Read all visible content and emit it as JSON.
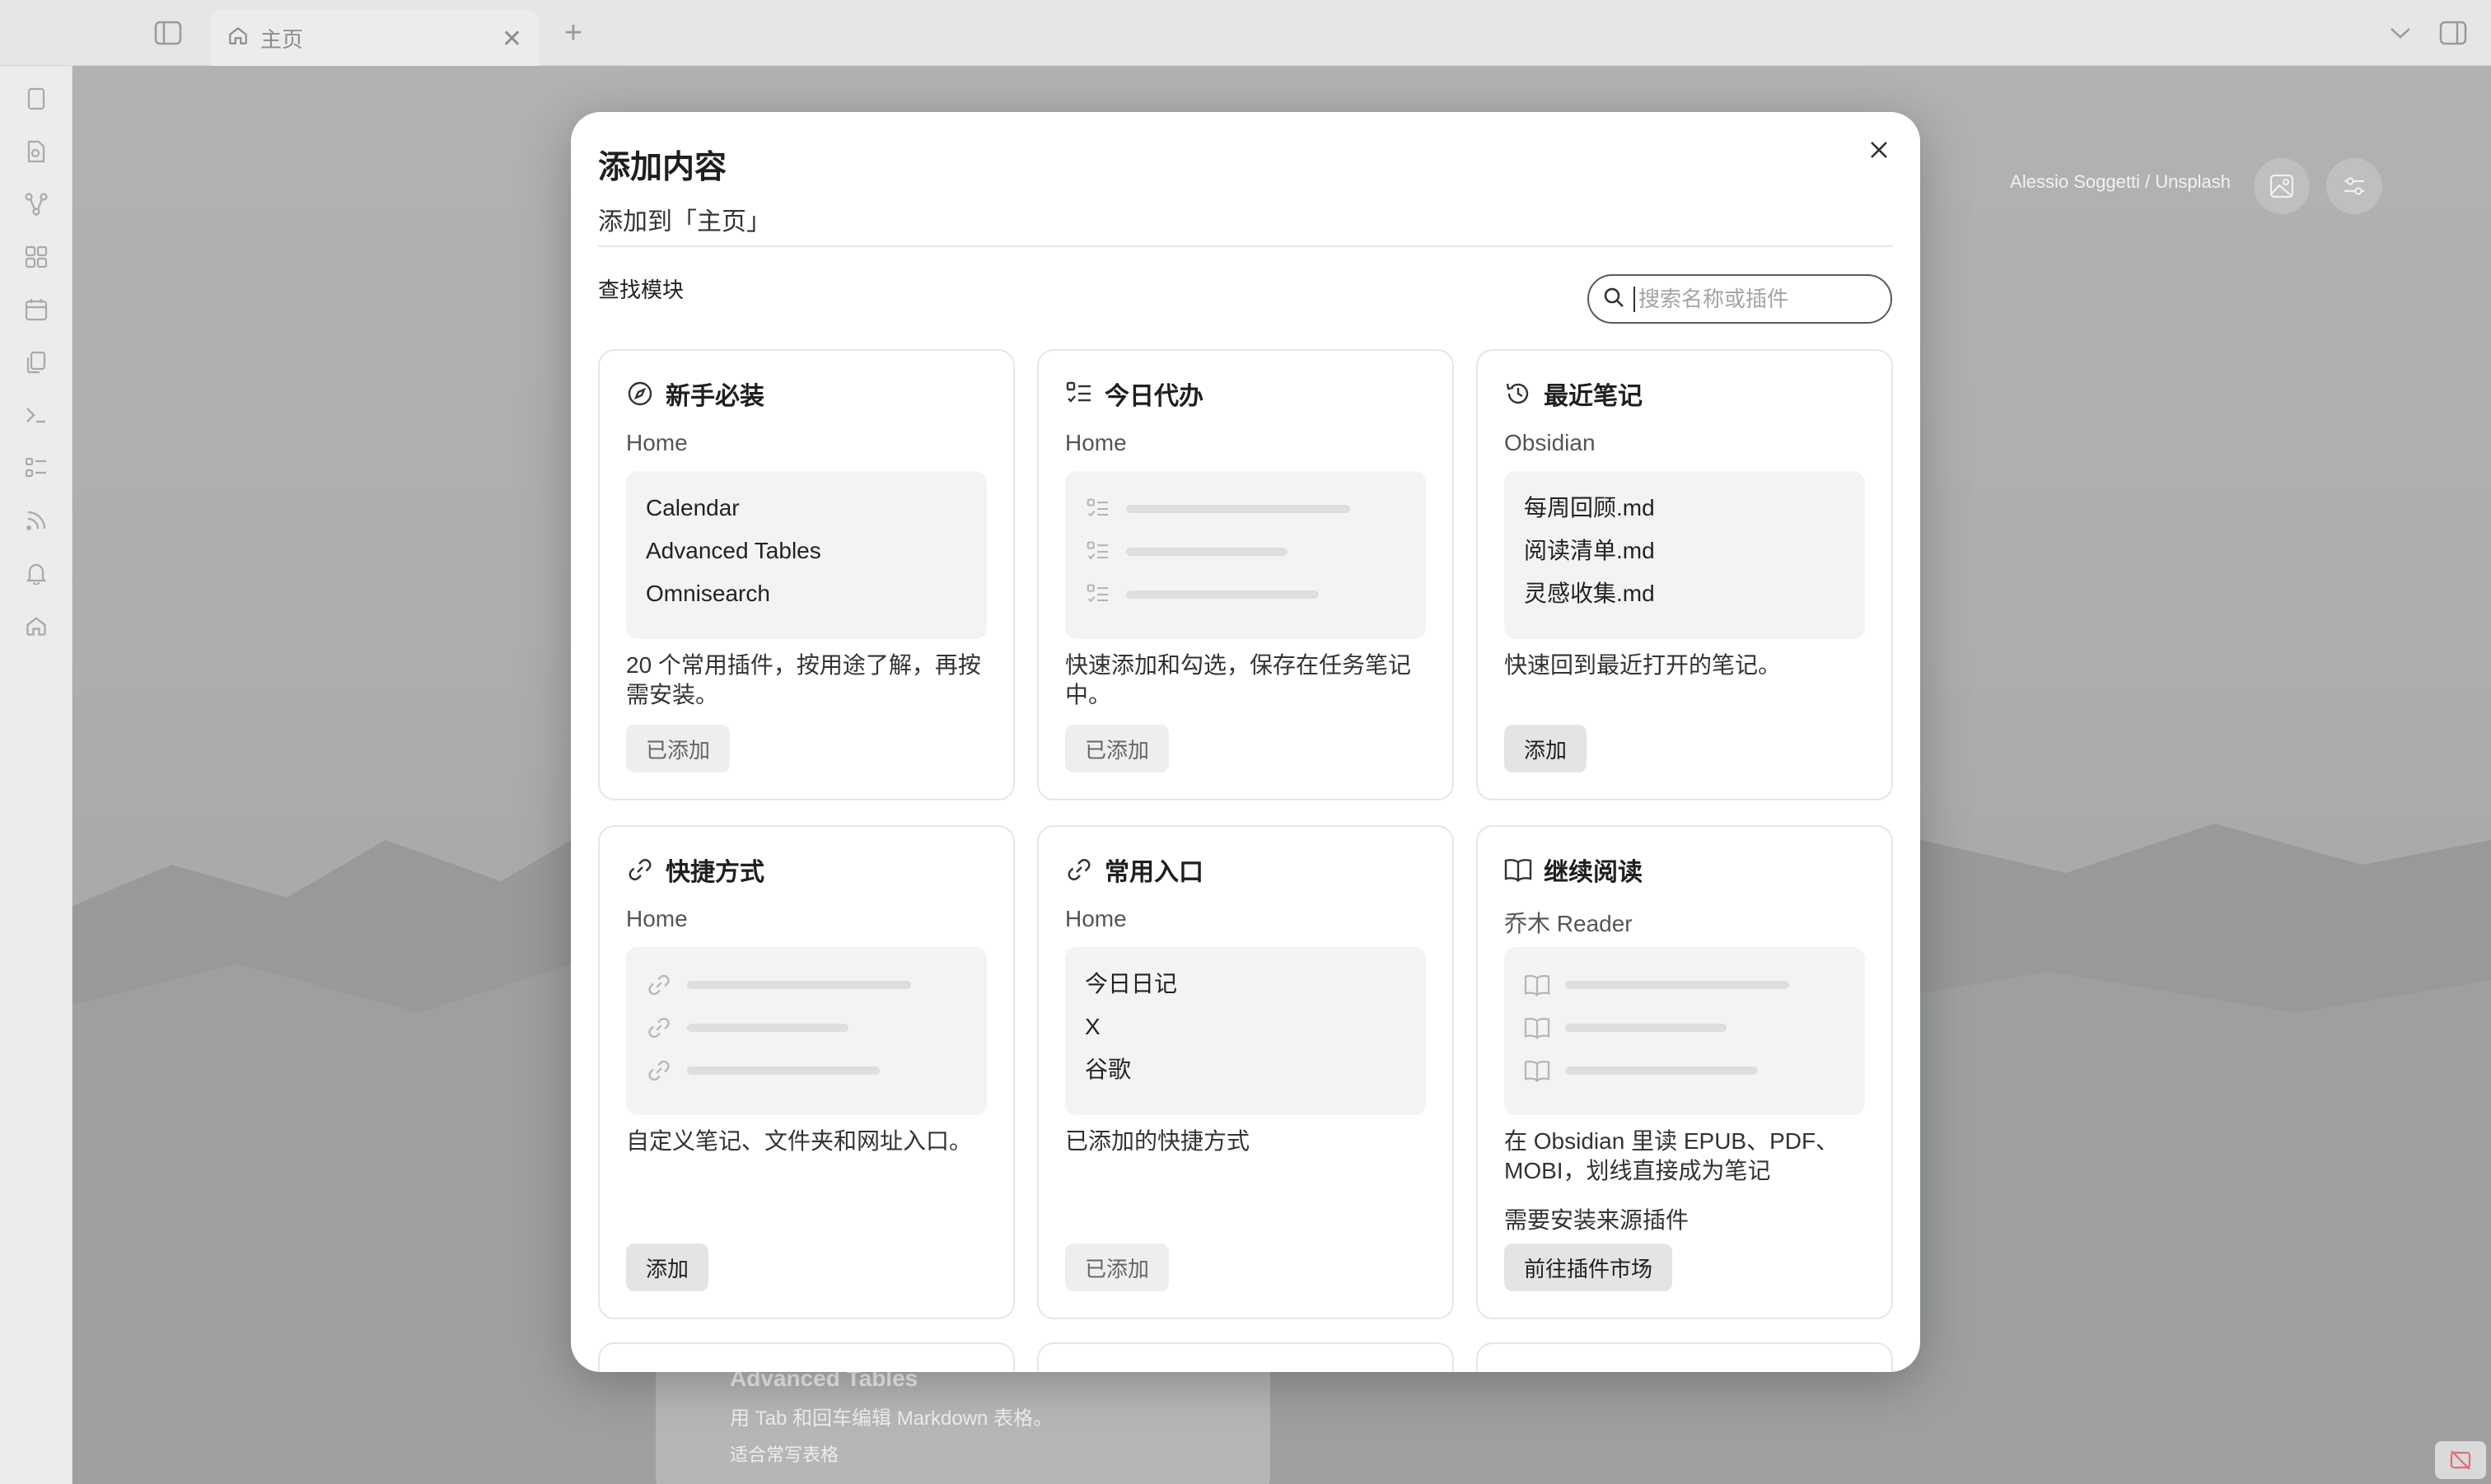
{
  "titlebar": {
    "tab_label": "主页"
  },
  "workspace": {
    "photo_credit": "Alessio Soggetti / Unsplash",
    "bg_card": {
      "title": "Advanced Tables",
      "desc": "用 Tab 和回车编辑 Markdown 表格。",
      "sub": "适合常写表格"
    }
  },
  "modal": {
    "title": "添加内容",
    "subtitle": "添加到「主页」",
    "find_label": "查找模块",
    "search_placeholder": "搜索名称或插件",
    "cards": [
      {
        "icon": "compass-icon",
        "title": "新手必装",
        "source": "Home",
        "preview_lines": [
          "Calendar",
          "Advanced Tables",
          "Omnisearch"
        ],
        "desc": "20 个常用插件，按用途了解，再按需安装。",
        "button": "已添加",
        "button_state": "added"
      },
      {
        "icon": "checklist-icon",
        "title": "今日代办",
        "source": "Home",
        "preview_skeleton": "checklist-icon",
        "desc": "快速添加和勾选，保存在任务笔记中。",
        "button": "已添加",
        "button_state": "added"
      },
      {
        "icon": "history-icon",
        "title": "最近笔记",
        "source": "Obsidian",
        "preview_lines": [
          "每周回顾.md",
          "阅读清单.md",
          "灵感收集.md"
        ],
        "desc": "快速回到最近打开的笔记。",
        "button": "添加",
        "button_state": "add"
      },
      {
        "icon": "link-icon",
        "title": "快捷方式",
        "source": "Home",
        "preview_skeleton": "link-icon",
        "desc": "自定义笔记、文件夹和网址入口。",
        "button": "添加",
        "button_state": "add"
      },
      {
        "icon": "link-icon",
        "title": "常用入口",
        "source": "Home",
        "preview_lines": [
          "今日日记",
          "X",
          "谷歌"
        ],
        "desc": "已添加的快捷方式",
        "button": "已添加",
        "button_state": "added"
      },
      {
        "icon": "book-icon",
        "title": "继续阅读",
        "source": "乔木 Reader",
        "preview_skeleton": "book-icon",
        "desc": "在 Obsidian 里读 EPUB、PDF、MOBI，划线直接成为笔记",
        "note": "需要安装来源插件",
        "button": "前往插件市场",
        "button_state": "add"
      }
    ]
  }
}
